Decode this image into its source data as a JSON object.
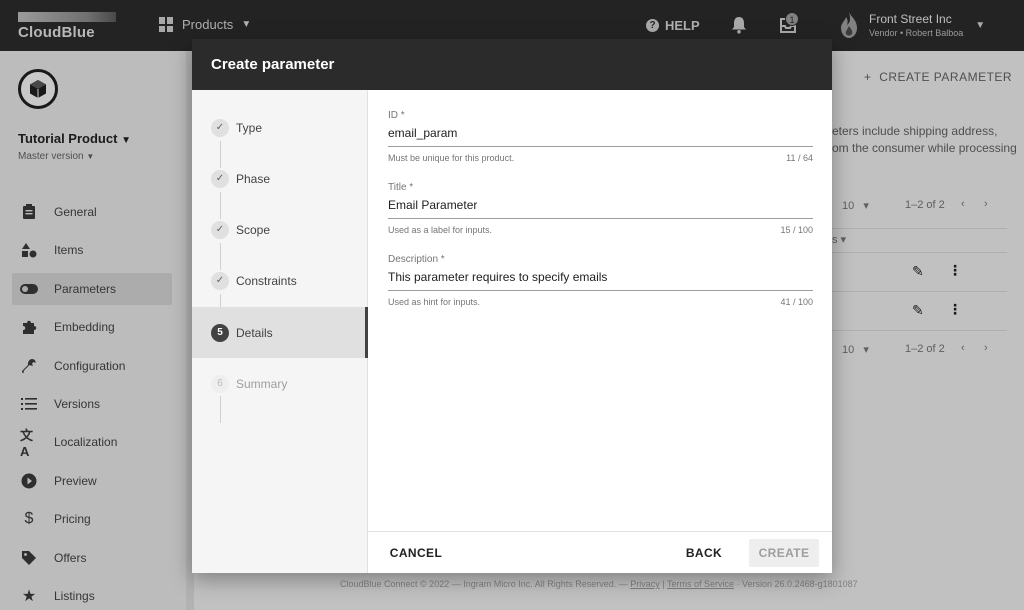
{
  "topbar": {
    "brand": "CloudBlue",
    "products_label": "Products",
    "help_label": "HELP",
    "inbox_count": "1",
    "account_name": "Front Street Inc",
    "account_role": "Vendor • Robert Balboa"
  },
  "sidebar": {
    "product_name": "Tutorial Product",
    "product_version": "Master version",
    "items": [
      {
        "label": "General",
        "icon": "clipboard-icon"
      },
      {
        "label": "Items",
        "icon": "shapes-icon"
      },
      {
        "label": "Parameters",
        "icon": "toggle-icon",
        "active": true
      },
      {
        "label": "Embedding",
        "icon": "puzzle-icon"
      },
      {
        "label": "Configuration",
        "icon": "wrench-icon"
      },
      {
        "label": "Versions",
        "icon": "list-icon"
      },
      {
        "label": "Localization",
        "icon": "translate-icon"
      },
      {
        "label": "Preview",
        "icon": "play-icon"
      },
      {
        "label": "Pricing",
        "icon": "dollar-icon"
      },
      {
        "label": "Offers",
        "icon": "tag-icon"
      },
      {
        "label": "Listings",
        "icon": "star-icon"
      }
    ]
  },
  "background": {
    "create_parameter_label": "CREATE PARAMETER",
    "description_line1": "eters include shipping address,",
    "description_line2": "om the consumer while processing",
    "page_size": "10",
    "range": "1–2 of 2",
    "column_hint": "s"
  },
  "footer": {
    "copyright": "CloudBlue Connect © 2022 — Ingram Micro Inc. All Rights Reserved. —",
    "privacy": "Privacy",
    "terms": "Terms of Service",
    "version": "· Version 26.0.2468-g1801087"
  },
  "modal": {
    "title": "Create parameter",
    "steps": [
      {
        "number": "1",
        "label": "Type",
        "state": "done"
      },
      {
        "number": "2",
        "label": "Phase",
        "state": "done"
      },
      {
        "number": "3",
        "label": "Scope",
        "state": "done"
      },
      {
        "number": "4",
        "label": "Constraints",
        "state": "done"
      },
      {
        "number": "5",
        "label": "Details",
        "state": "current"
      },
      {
        "number": "6",
        "label": "Summary",
        "state": "todo"
      }
    ],
    "fields": {
      "id": {
        "label": "ID *",
        "value": "email_param",
        "hint": "Must be unique for this product.",
        "counter": "11 / 64"
      },
      "title": {
        "label": "Title *",
        "value": "Email Parameter",
        "hint": "Used as a label for inputs.",
        "counter": "15 / 100"
      },
      "description": {
        "label": "Description *",
        "value": "This parameter requires to specify emails",
        "hint": "Used as hint for inputs.",
        "counter": "41 / 100"
      }
    },
    "buttons": {
      "cancel": "CANCEL",
      "back": "BACK",
      "create": "CREATE"
    }
  },
  "colors": {
    "topbar": "#2b2b2b",
    "sidebar": "#e6e6e6",
    "active_step": "#424242"
  }
}
